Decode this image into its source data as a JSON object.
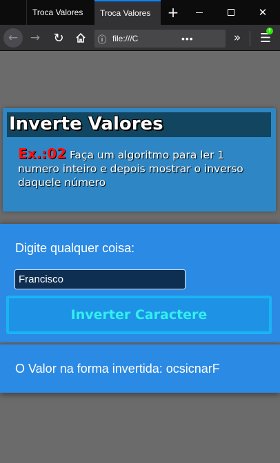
{
  "browser": {
    "tabs": [
      {
        "label": "Troca Valores"
      },
      {
        "label": "Troca Valores"
      }
    ],
    "new_tab_glyph": "+",
    "url": "file:///C",
    "page_actions_glyph": "•••",
    "icons": {
      "back": "arrow-left-icon",
      "forward": "arrow-right-icon",
      "reload": "reload-icon",
      "home": "home-icon",
      "info": "info-icon",
      "pocket": "pocket-icon",
      "bookmark": "star-icon",
      "overflow": "double-chevron-icon",
      "menu": "hamburger-menu-icon"
    },
    "colors": {
      "accent": "#0a84ff",
      "update_badge": "#30e60b"
    }
  },
  "page": {
    "title": "Inverte Valores",
    "exercise_label": "Ex.:02",
    "exercise_text": "Faça um algoritmo para ler 1 numero inteiro e depois mostrar o inverso daquele número",
    "prompt": "Digite qualquer coisa:",
    "input_value": "Francisco",
    "button_label": "Inverter Caractere",
    "result_text": "O Valor na forma invertida: ocsicnarF",
    "colors": {
      "header_bg": "#2e87c4",
      "title_bar": "#12455f",
      "card_bg": "#2b8ae4",
      "exercise_label": "#ff1010",
      "button_text": "#32f0f0",
      "button_border": "#19b4f5"
    }
  }
}
